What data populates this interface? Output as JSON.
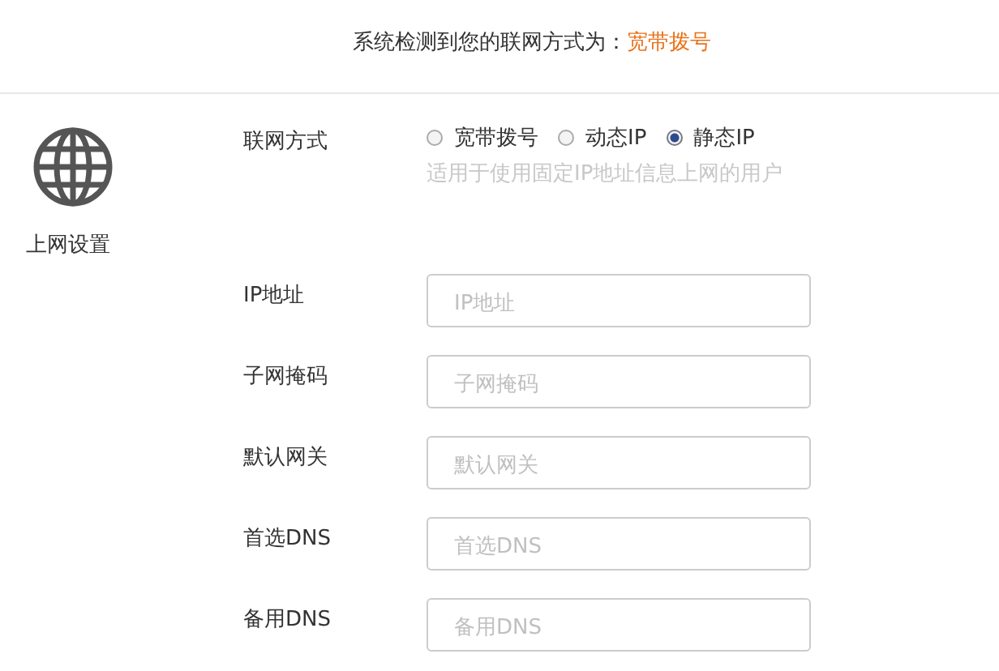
{
  "detection": {
    "prefix": "系统检测到您的联网方式为：",
    "value": "宽带拨号"
  },
  "sidebar": {
    "label": "上网设置"
  },
  "connection_type": {
    "label": "联网方式",
    "hint": "适用于使用固定IP地址信息上网的用户",
    "options": [
      {
        "label": "宽带拨号",
        "selected": false
      },
      {
        "label": "动态IP",
        "selected": false
      },
      {
        "label": "静态IP",
        "selected": true
      }
    ]
  },
  "fields": [
    {
      "label": "IP地址",
      "placeholder": "IP地址"
    },
    {
      "label": "子网掩码",
      "placeholder": "子网掩码"
    },
    {
      "label": "默认网关",
      "placeholder": "默认网关"
    },
    {
      "label": "首选DNS",
      "placeholder": "首选DNS"
    },
    {
      "label": "备用DNS",
      "placeholder": "备用DNS"
    }
  ]
}
